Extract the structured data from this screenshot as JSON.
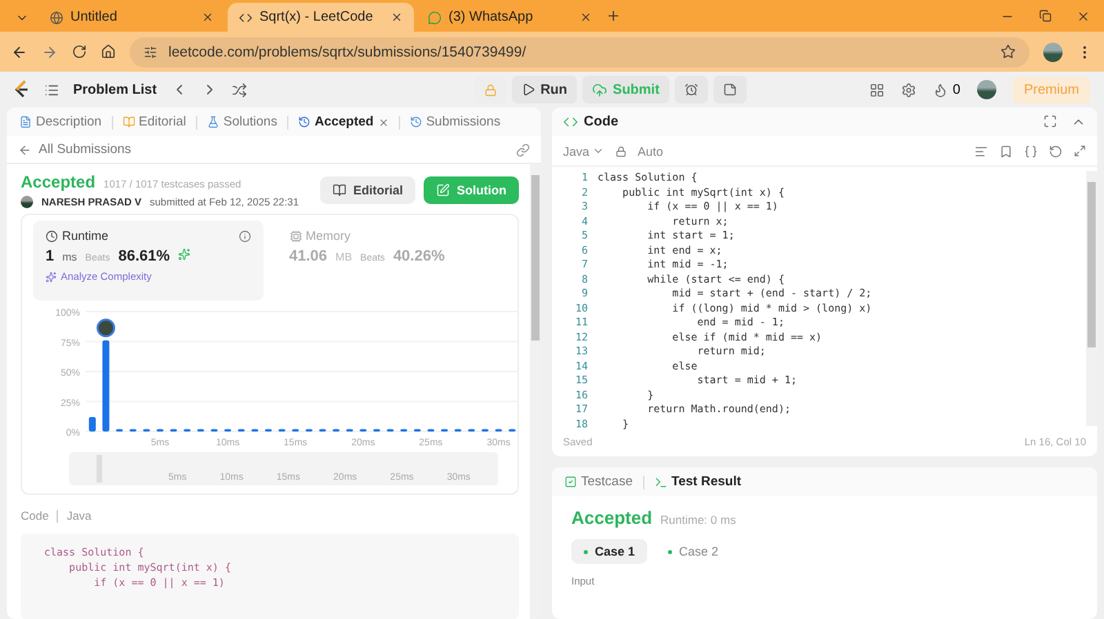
{
  "browser": {
    "tabs": [
      {
        "title": "Untitled",
        "selected": false,
        "kind": "globe"
      },
      {
        "title": "Sqrt(x) - LeetCode",
        "selected": true,
        "kind": "leetcode"
      },
      {
        "title": "(3) WhatsApp",
        "selected": false,
        "kind": "whatsapp"
      }
    ],
    "url": "leetcode.com/problems/sqrtx/submissions/1540739499/"
  },
  "nav": {
    "problem_list": "Problem List",
    "run": "Run",
    "submit": "Submit",
    "streak": "0",
    "premium": "Premium"
  },
  "left": {
    "tabs": [
      {
        "label": "Description",
        "selected": false,
        "kind": "doc"
      },
      {
        "label": "Editorial",
        "selected": false,
        "kind": "book"
      },
      {
        "label": "Solutions",
        "selected": false,
        "kind": "flask"
      },
      {
        "label": "Accepted",
        "selected": true,
        "kind": "history"
      },
      {
        "label": "Submissions",
        "selected": false,
        "kind": "history"
      }
    ],
    "back": "All Submissions",
    "status": "Accepted",
    "cases": "1017 / 1017 testcases passed",
    "author": "NARESH PRASAD V",
    "submitted": "submitted at Feb 12, 2025 22:31",
    "editorial_button": "Editorial",
    "solution_button": "Solution",
    "runtime": {
      "title": "Runtime",
      "value": "1",
      "unit": "ms",
      "beats": "Beats",
      "percent": "86.61%",
      "analyze": "Analyze Complexity",
      "selected": true
    },
    "memory": {
      "title": "Memory",
      "value": "41.06",
      "unit": "MB",
      "beats": "Beats",
      "percent": "40.26%",
      "selected": false
    },
    "chart_data": {
      "type": "bar",
      "grid": true,
      "x": [
        0,
        1,
        2,
        3,
        4,
        5,
        6,
        7,
        8,
        9,
        10,
        11,
        12,
        13,
        14,
        15,
        16,
        17,
        18,
        19,
        20,
        21,
        22,
        23,
        24,
        25,
        26,
        27,
        28,
        29,
        30,
        31
      ],
      "xlim": [
        -0.5,
        31.5
      ],
      "series": [
        {
          "color": "#1a73e8",
          "values": [
            12,
            76,
            2,
            2,
            2,
            2,
            2,
            2,
            2,
            2,
            2,
            2,
            2,
            2,
            2,
            2,
            2,
            2,
            2,
            2,
            2,
            2,
            2,
            2,
            2,
            2,
            2,
            2,
            2,
            2,
            2,
            2
          ]
        }
      ],
      "ylim": [
        0,
        100
      ],
      "yticks": [
        {
          "value": 0,
          "label": "0%"
        },
        {
          "value": 25,
          "label": "25%"
        },
        {
          "value": 50,
          "label": "50%"
        },
        {
          "value": 75,
          "label": "75%"
        },
        {
          "value": 100,
          "label": "100%"
        }
      ],
      "xticks": [
        {
          "value": 5,
          "label": "5ms"
        },
        {
          "value": 10,
          "label": "10ms"
        },
        {
          "value": 15,
          "label": "15ms"
        },
        {
          "value": 20,
          "label": "20ms"
        },
        {
          "value": 25,
          "label": "25ms"
        },
        {
          "value": 30,
          "label": "30ms"
        }
      ]
    },
    "navigator_labels": [
      "5ms",
      "10ms",
      "15ms",
      "20ms",
      "25ms",
      "30ms"
    ],
    "code_label": "Code",
    "code_lang": "Java",
    "code": [
      "class Solution {",
      "    public int mySqrt(int x) {",
      "        if (x == 0 || x == 1)"
    ]
  },
  "editor": {
    "title": "Code",
    "language": "Java",
    "mode": "Auto",
    "lines": [
      {
        "n": "1",
        "text": "class Solution {"
      },
      {
        "n": "2",
        "text": "    public int mySqrt(int x) {"
      },
      {
        "n": "3",
        "text": "        if (x == 0 || x == 1)"
      },
      {
        "n": "4",
        "text": "            return x;"
      },
      {
        "n": "5",
        "text": "        int start = 1;"
      },
      {
        "n": "6",
        "text": "        int end = x;"
      },
      {
        "n": "7",
        "text": "        int mid = -1;"
      },
      {
        "n": "8",
        "text": "        while (start <= end) {"
      },
      {
        "n": "9",
        "text": "            mid = start + (end - start) / 2;"
      },
      {
        "n": "10",
        "text": "            if ((long) mid * mid > (long) x)"
      },
      {
        "n": "11",
        "text": "                end = mid - 1;"
      },
      {
        "n": "12",
        "text": "            else if (mid * mid == x)"
      },
      {
        "n": "13",
        "text": "                return mid;"
      },
      {
        "n": "14",
        "text": "            else"
      },
      {
        "n": "15",
        "text": "                start = mid + 1;"
      },
      {
        "n": "16",
        "text": "        }"
      },
      {
        "n": "17",
        "text": "        return Math.round(end);"
      },
      {
        "n": "18",
        "text": "    }"
      }
    ],
    "saved": "Saved",
    "cursor": "Ln 16, Col 10"
  },
  "result": {
    "tabs": [
      {
        "label": "Testcase",
        "selected": false,
        "kind": "check"
      },
      {
        "label": "Test Result",
        "selected": true,
        "kind": "terminal"
      }
    ],
    "status": "Accepted",
    "runtime": "Runtime: 0 ms",
    "cases": [
      {
        "label": "Case 1",
        "selected": true
      },
      {
        "label": "Case 2",
        "selected": false
      }
    ],
    "input_label": "Input"
  }
}
